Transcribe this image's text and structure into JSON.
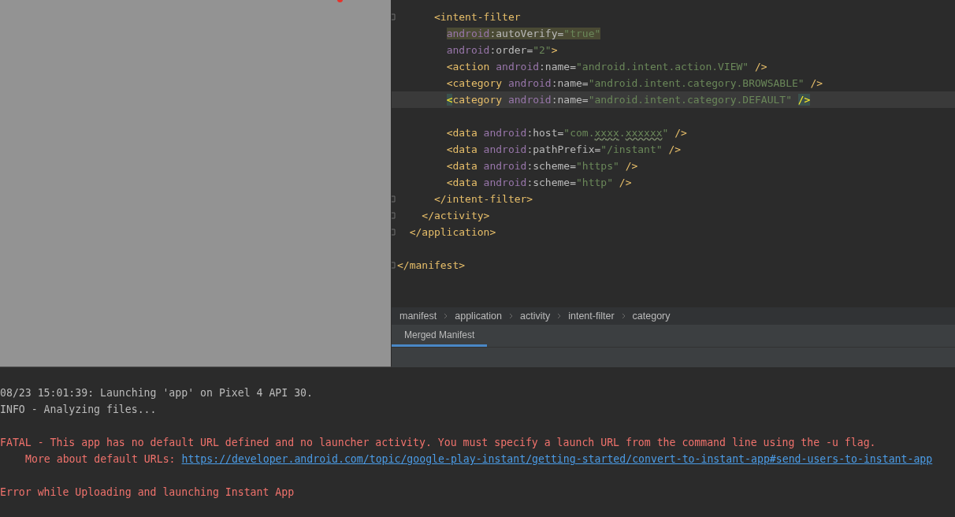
{
  "editor": {
    "lines": [
      {
        "kind": "group",
        "children": [
          {
            "kind": "group",
            "children": [
              {
                "kind": "group",
                "children": [
                  {
                    "kind": "code",
                    "fold": true,
                    "current": false,
                    "tokens": [
                      {
                        "kind": "tag",
                        "text": "<intent-filter"
                      }
                    ]
                  },
                  {
                    "kind": "group",
                    "children": [
                      {
                        "kind": "code",
                        "fold": false,
                        "current": false,
                        "tokens": [
                          {
                            "kind": "ns",
                            "text": "android",
                            "highlight": true
                          },
                          {
                            "kind": "attr",
                            "text": ":autoVerify=",
                            "highlight": true
                          },
                          {
                            "kind": "string",
                            "text": "\"true\"",
                            "highlight": true
                          }
                        ]
                      },
                      {
                        "kind": "code",
                        "fold": false,
                        "current": false,
                        "tokens": [
                          {
                            "kind": "ns",
                            "text": "android"
                          },
                          {
                            "kind": "attr",
                            "text": ":order="
                          },
                          {
                            "kind": "string",
                            "text": "\"2\""
                          },
                          {
                            "kind": "tag",
                            "text": ">"
                          }
                        ]
                      },
                      {
                        "kind": "code",
                        "fold": false,
                        "current": false,
                        "tokens": [
                          {
                            "kind": "tag",
                            "text": "<action "
                          },
                          {
                            "kind": "ns",
                            "text": "android"
                          },
                          {
                            "kind": "attr",
                            "text": ":name="
                          },
                          {
                            "kind": "string",
                            "text": "\"android.intent.action.VIEW\" "
                          },
                          {
                            "kind": "tag",
                            "text": "/>"
                          }
                        ]
                      },
                      {
                        "kind": "code",
                        "fold": false,
                        "current": false,
                        "tokens": [
                          {
                            "kind": "tag",
                            "text": "<category "
                          },
                          {
                            "kind": "ns",
                            "text": "android"
                          },
                          {
                            "kind": "attr",
                            "text": ":name="
                          },
                          {
                            "kind": "string",
                            "text": "\"android.intent.category.BROWSABLE\" "
                          },
                          {
                            "kind": "tag",
                            "text": "/>"
                          }
                        ]
                      },
                      {
                        "kind": "code",
                        "fold": false,
                        "current": true,
                        "tokens": [
                          {
                            "kind": "tag",
                            "text": "<",
                            "match": true
                          },
                          {
                            "kind": "tag",
                            "text": "category "
                          },
                          {
                            "kind": "ns",
                            "text": "android"
                          },
                          {
                            "kind": "attr",
                            "text": ":name="
                          },
                          {
                            "kind": "string",
                            "text": "\"android.intent.category.DEFAULT\" "
                          },
                          {
                            "kind": "tag",
                            "text": "/>",
                            "match": true
                          }
                        ]
                      },
                      {
                        "kind": "blank"
                      },
                      {
                        "kind": "code",
                        "fold": false,
                        "current": false,
                        "tokens": [
                          {
                            "kind": "tag",
                            "text": "<data "
                          },
                          {
                            "kind": "ns",
                            "text": "android"
                          },
                          {
                            "kind": "attr",
                            "text": ":host="
                          },
                          {
                            "kind": "string",
                            "text": "\"com."
                          },
                          {
                            "kind": "string",
                            "text": "xxxx",
                            "typo": true
                          },
                          {
                            "kind": "string",
                            "text": "."
                          },
                          {
                            "kind": "string",
                            "text": "xxxxxx",
                            "typo": true
                          },
                          {
                            "kind": "string",
                            "text": "\" "
                          },
                          {
                            "kind": "tag",
                            "text": "/>"
                          }
                        ]
                      },
                      {
                        "kind": "code",
                        "fold": false,
                        "current": false,
                        "tokens": [
                          {
                            "kind": "tag",
                            "text": "<data "
                          },
                          {
                            "kind": "ns",
                            "text": "android"
                          },
                          {
                            "kind": "attr",
                            "text": ":pathPrefix="
                          },
                          {
                            "kind": "string",
                            "text": "\"/instant\" "
                          },
                          {
                            "kind": "tag",
                            "text": "/>"
                          }
                        ]
                      },
                      {
                        "kind": "code",
                        "fold": false,
                        "current": false,
                        "tokens": [
                          {
                            "kind": "tag",
                            "text": "<data "
                          },
                          {
                            "kind": "ns",
                            "text": "android"
                          },
                          {
                            "kind": "attr",
                            "text": ":scheme="
                          },
                          {
                            "kind": "string",
                            "text": "\"https\" "
                          },
                          {
                            "kind": "tag",
                            "text": "/>"
                          }
                        ]
                      },
                      {
                        "kind": "code",
                        "fold": false,
                        "current": false,
                        "tokens": [
                          {
                            "kind": "tag",
                            "text": "<data "
                          },
                          {
                            "kind": "ns",
                            "text": "android"
                          },
                          {
                            "kind": "attr",
                            "text": ":scheme="
                          },
                          {
                            "kind": "string",
                            "text": "\"http\" "
                          },
                          {
                            "kind": "tag",
                            "text": "/>"
                          }
                        ]
                      }
                    ]
                  },
                  {
                    "kind": "code",
                    "fold": true,
                    "current": false,
                    "tokens": [
                      {
                        "kind": "tag",
                        "text": "</intent-filter>"
                      }
                    ]
                  }
                ]
              },
              {
                "kind": "code",
                "fold": true,
                "current": false,
                "tokens": [
                  {
                    "kind": "tag",
                    "text": "</activity>"
                  }
                ]
              }
            ]
          },
          {
            "kind": "code",
            "fold": true,
            "current": false,
            "tokens": [
              {
                "kind": "tag",
                "text": "</application>"
              }
            ]
          }
        ]
      },
      {
        "kind": "blank"
      },
      {
        "kind": "code",
        "fold": true,
        "current": false,
        "tokens": [
          {
            "kind": "tag",
            "text": "</manifest>"
          }
        ]
      }
    ]
  },
  "breadcrumbs": [
    "manifest",
    "application",
    "activity",
    "intent-filter",
    "category"
  ],
  "tabs": [
    {
      "label": "Merged Manifest",
      "selected": true
    }
  ],
  "console": {
    "blocks": [
      {
        "lines": [
          {
            "kind": "info",
            "text": "08/23 15:01:39: Launching 'app' on Pixel 4 API 30."
          },
          {
            "kind": "info",
            "text": "INFO - Analyzing files..."
          }
        ]
      },
      {
        "lines": [
          {
            "kind": "error",
            "text": "FATAL - This app has no default URL defined and no launcher activity. You must specify a launch URL from the command line using the -u flag."
          },
          {
            "kind": "error-detail",
            "text": "More about default URLs: ",
            "link": "https://developer.android.com/topic/google-play-instant/getting-started/convert-to-instant-app#send-users-to-instant-app"
          }
        ]
      },
      {
        "lines": [
          {
            "kind": "error",
            "text": "Error while Uploading and launching Instant App"
          }
        ]
      }
    ]
  }
}
